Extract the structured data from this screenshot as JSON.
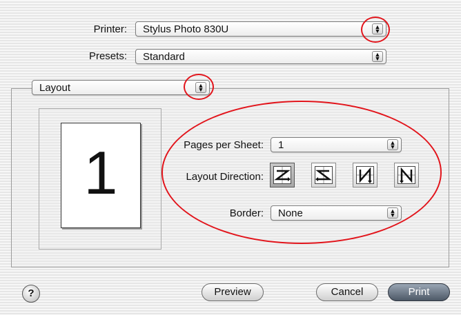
{
  "printer": {
    "label": "Printer:",
    "value": "Stylus Photo 830U"
  },
  "presets": {
    "label": "Presets:",
    "value": "Standard"
  },
  "pane": {
    "value": "Layout"
  },
  "preview_page": {
    "number": "1"
  },
  "pages_per_sheet": {
    "label": "Pages per Sheet:",
    "value": "1"
  },
  "layout_direction": {
    "label": "Layout Direction:",
    "options": [
      "left-right-top-bottom",
      "right-left-top-bottom",
      "top-bottom-left-right",
      "top-bottom-right-left"
    ],
    "selected": 0
  },
  "border": {
    "label": "Border:",
    "value": "None"
  },
  "buttons": {
    "help": "?",
    "preview": "Preview",
    "cancel": "Cancel",
    "print": "Print"
  },
  "colors": {
    "highlight_ellipse": "#e2141b",
    "default_button": "#4d5866"
  }
}
